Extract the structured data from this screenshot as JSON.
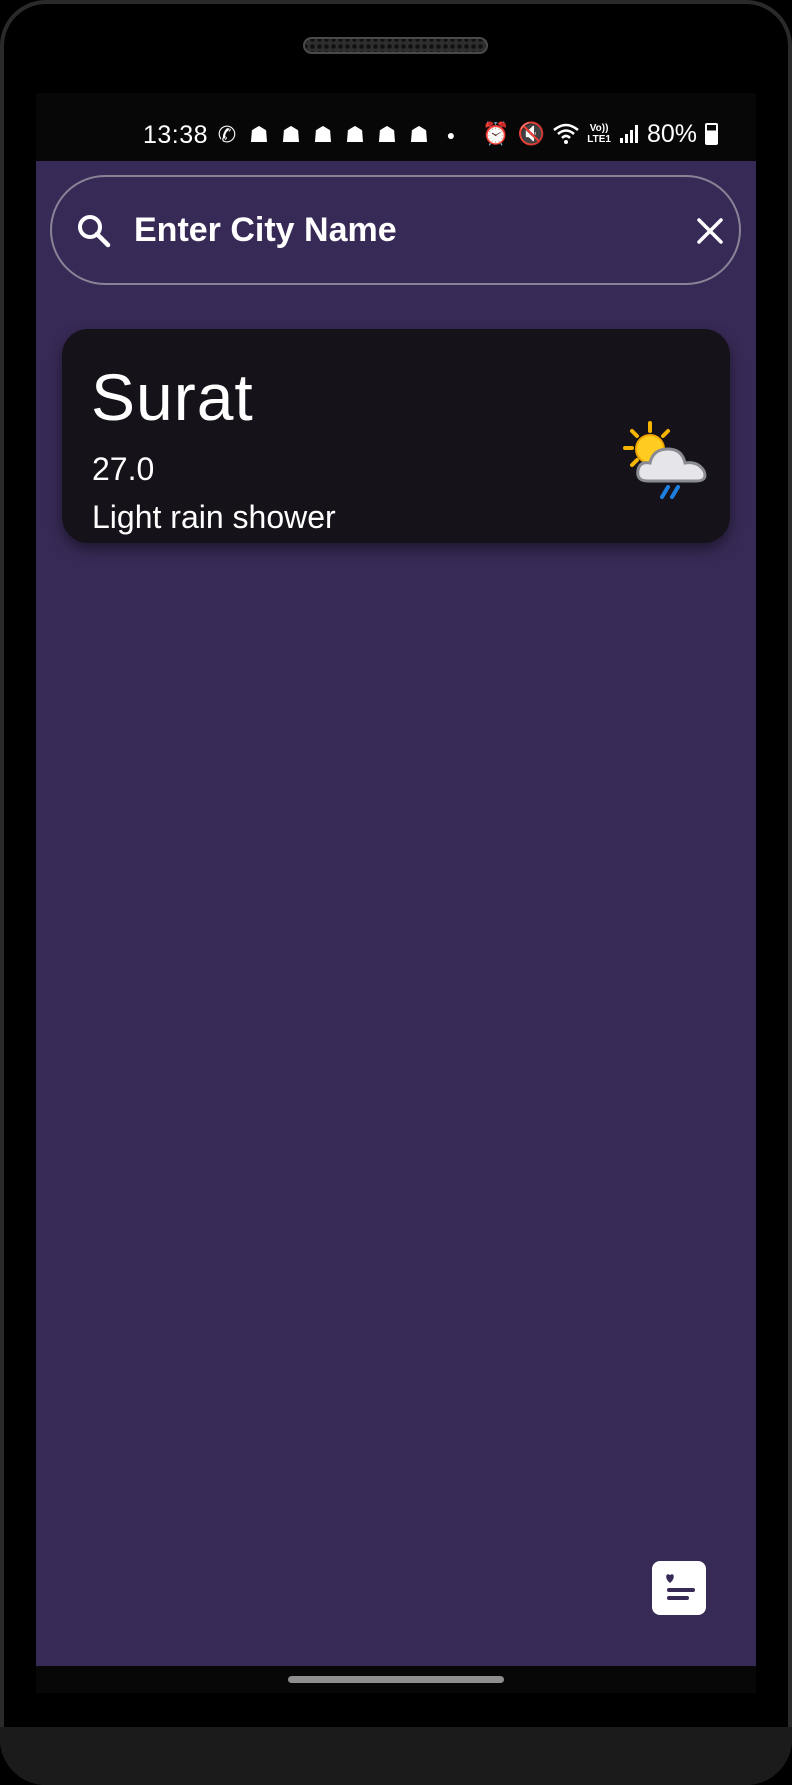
{
  "status_bar": {
    "time": "13:38",
    "battery": "80%",
    "network_label": "LTE1",
    "volte_label": "Vo))",
    "notification_icons": [
      "whatsapp-icon",
      "snapchat-icon",
      "snapchat-icon",
      "snapchat-icon",
      "snapchat-icon",
      "snapchat-icon",
      "snapchat-icon",
      "dot-icon"
    ],
    "system_icons": [
      "alarm-icon",
      "mute-icon",
      "wifi-icon",
      "signal-icon",
      "battery-charging-icon"
    ]
  },
  "search": {
    "placeholder": "Enter City Name",
    "value": ""
  },
  "weather_card": {
    "city": "Surat",
    "temperature": "27.0",
    "condition": "Light rain shower",
    "icon": "sun-cloud-rain-icon"
  },
  "fab": {
    "icon": "favorites-list-icon"
  },
  "colors": {
    "background": "#382a56",
    "card": "#161219",
    "status_bar": "#070707",
    "text": "#ffffff"
  }
}
